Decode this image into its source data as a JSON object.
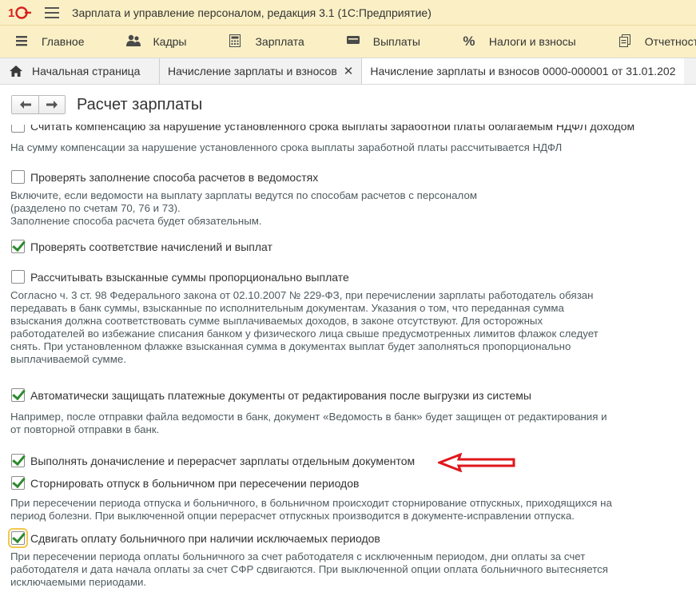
{
  "app": {
    "title": "Зарплата и управление персоналом, редакция 3.1  (1С:Предприятие)"
  },
  "sections": [
    {
      "label": "Главное",
      "icon": "menu-list-icon"
    },
    {
      "label": "Кадры",
      "icon": "people-icon"
    },
    {
      "label": "Зарплата",
      "icon": "calculator-icon"
    },
    {
      "label": "Выплаты",
      "icon": "wallet-icon"
    },
    {
      "label": "Налоги и взносы",
      "icon": "percent-icon"
    },
    {
      "label": "Отчетность, справ",
      "icon": "reports-icon"
    }
  ],
  "tabs": {
    "home": "Начальная страница",
    "tab1": "Начисление зарплаты и взносов",
    "tab2": "Начисление зарплаты и взносов 0000-000001 от 31.01.202"
  },
  "form": {
    "title": "Расчет зарплаты"
  },
  "options": {
    "cut_label": "Считать компенсацию за нарушение установленного срока выплаты заработной платы облагаемым НДФЛ доходом",
    "cut_hint": "На сумму компенсации за нарушение установленного срока выплаты заработной платы рассчитывается НДФЛ",
    "check_payment_method": {
      "label": "Проверять заполнение способа расчетов в ведомостях",
      "checked": false,
      "hint": "Включите, если ведомости на выплату зарплаты ведутся по способам расчетов с персоналом\n(разделено по счетам 70, 76 и 73).\nЗаполнение способа расчета будет обязательным."
    },
    "check_accruals": {
      "label": "Проверять соответствие начислений и выплат",
      "checked": true
    },
    "calc_proportional": {
      "label": "Рассчитывать взысканные суммы пропорционально выплате",
      "checked": false,
      "hint": "Согласно ч. 3 ст. 98 Федерального закона от 02.10.2007 № 229-ФЗ, при перечислении зарплаты работодатель обязан\nпередавать в банк суммы, взысканные по исполнительным документам. Указания о том, что переданная сумма\nвзыскания должна соответствовать сумме выплачиваемых доходов, в законе отсутствуют. Для осторожных\nработодателей во избежание списания банком у физического лица свыше предусмотренных лимитов флажок следует\nснять. При установленном флажке взысканная сумма в документах выплат будет заполняться пропорционально\nвыплачиваемой сумме."
    },
    "protect_payments": {
      "label": "Автоматически защищать платежные документы от редактирования после выгрузки из системы",
      "checked": true,
      "hint": "Например, после отправки файла ведомости в банк, документ «Ведомость в банк» будет защищен от редактирования и\nот повторной отправки в банк."
    },
    "separate_recalc": {
      "label": "Выполнять доначисление и перерасчет зарплаты отдельным документом",
      "checked": true
    },
    "reverse_vacation": {
      "label": "Сторнировать отпуск в больничном при пересечении периодов",
      "checked": true,
      "hint": "При пересечении периода отпуска и больничного, в больничном происходит сторнирование отпускных, приходящихся на\nпериод болезни. При выключенной опции перерасчет отпускных производится в документе-исправлении отпуска."
    },
    "shift_sick_pay": {
      "label": "Сдвигать оплату больничного при наличии исключаемых периодов",
      "checked": true,
      "hint": "При пересечении периода оплаты больничного за счет работодателя с исключенным периодом, дни оплаты за счет\nработодателя и дата начала оплаты за счет СФР сдвигаются. При выключенной опции оплата больничного вытесняется\nисключаемыми периодами."
    }
  },
  "colors": {
    "panel_bg": "#fbf0c5",
    "check_green": "#2e8b2e",
    "annotation_red": "#e0161b",
    "hint_text": "#4f5b5f"
  }
}
